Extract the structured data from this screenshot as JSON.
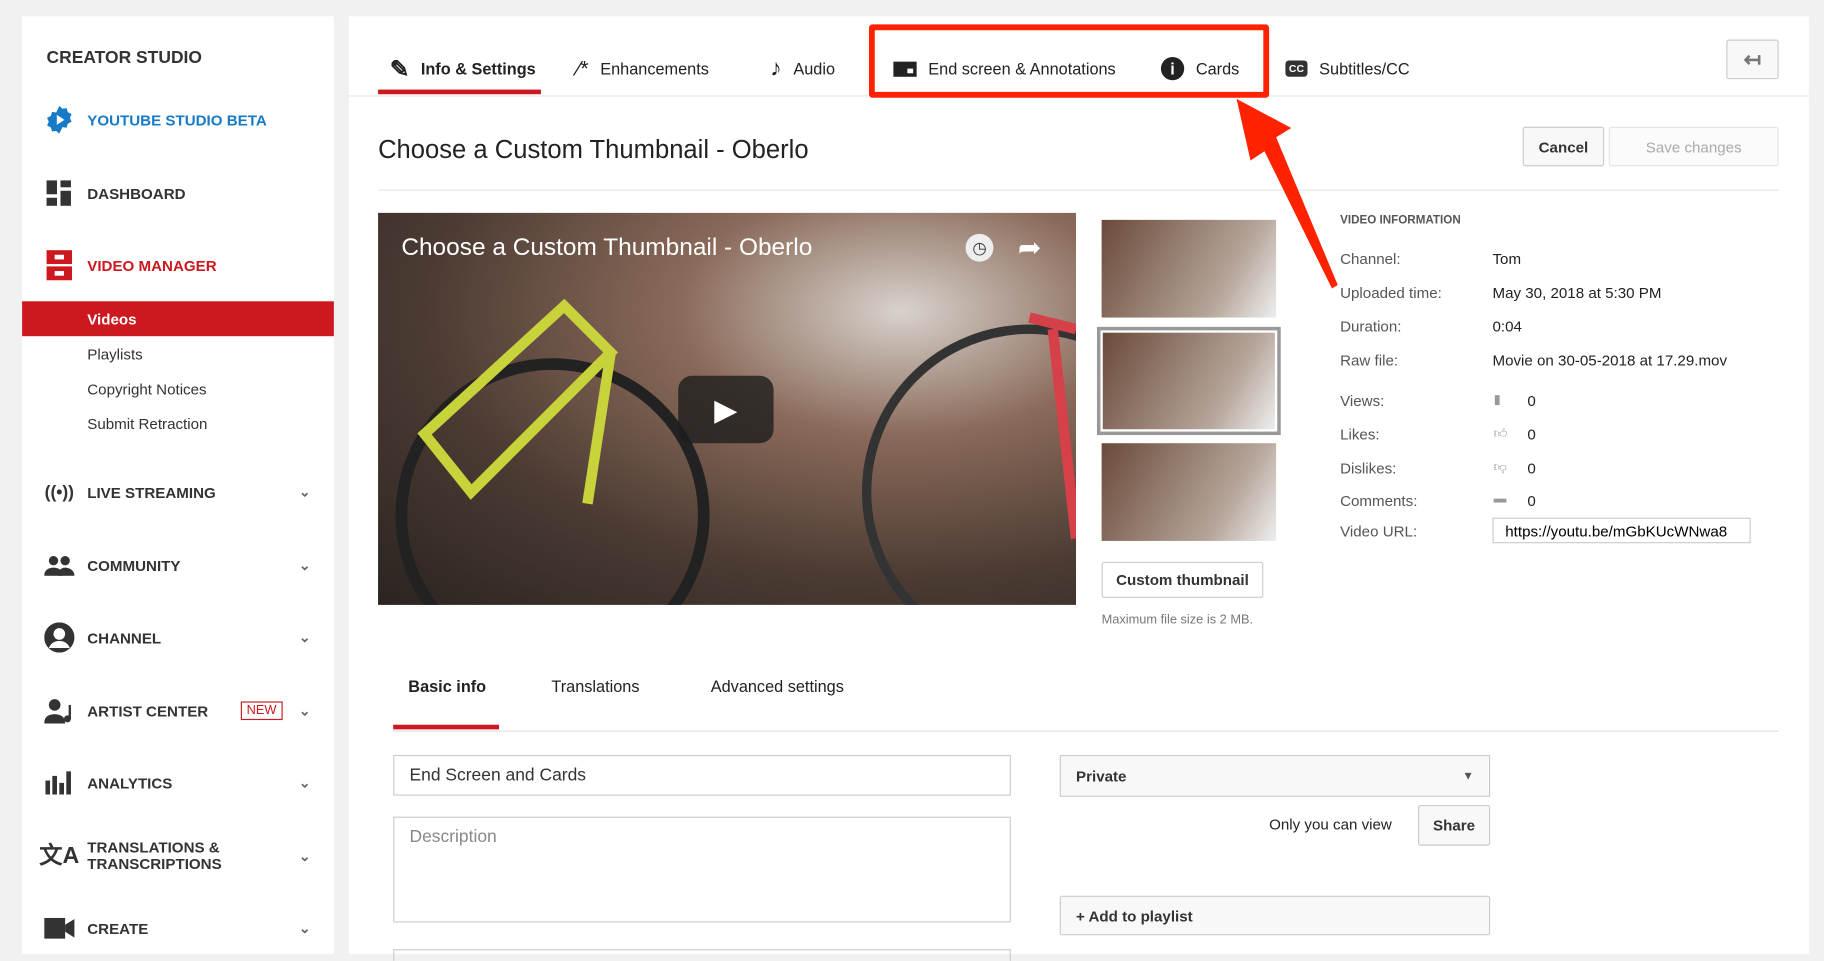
{
  "sidebar": {
    "brand": "CREATOR STUDIO",
    "studio_beta": "YOUTUBE STUDIO BETA",
    "dashboard": "DASHBOARD",
    "video_manager": "VIDEO MANAGER",
    "sub_items": [
      "Videos",
      "Playlists",
      "Copyright Notices",
      "Submit Retraction"
    ],
    "sections": [
      {
        "label": "LIVE STREAMING",
        "icon": "live-icon"
      },
      {
        "label": "COMMUNITY",
        "icon": "community-icon"
      },
      {
        "label": "CHANNEL",
        "icon": "channel-icon"
      },
      {
        "label": "ARTIST CENTER",
        "icon": "artist-icon",
        "badge": "NEW"
      },
      {
        "label": "ANALYTICS",
        "icon": "analytics-icon"
      },
      {
        "label": "TRANSLATIONS & TRANSCRIPTIONS",
        "icon": "translate-icon"
      },
      {
        "label": "CREATE",
        "icon": "camera-icon"
      }
    ]
  },
  "tabs": [
    "Info & Settings",
    "Enhancements",
    "Audio",
    "End screen & Annotations",
    "Cards",
    "Subtitles/CC"
  ],
  "page": {
    "title": "Choose a Custom Thumbnail - Oberlo",
    "cancel": "Cancel",
    "save": "Save changes"
  },
  "video": {
    "title": "Choose a Custom Thumbnail - Oberlo"
  },
  "thumbs": {
    "custom_button": "Custom thumbnail",
    "note": "Maximum file size is 2 MB."
  },
  "info": {
    "heading": "VIDEO INFORMATION",
    "rows": [
      [
        "Channel:",
        "Tom"
      ],
      [
        "Uploaded time:",
        "May 30, 2018 at 5:30 PM"
      ],
      [
        "Duration:",
        "0:04"
      ],
      [
        "Raw file:",
        "Movie on 30-05-2018 at 17.29.mov"
      ]
    ],
    "stats": [
      [
        "Views:",
        "0"
      ],
      [
        "Likes:",
        "0"
      ],
      [
        "Dislikes:",
        "0"
      ],
      [
        "Comments:",
        "0"
      ]
    ],
    "url_label": "Video URL:",
    "url": "https://youtu.be/mGbKUcWNwa8"
  },
  "subtabs": [
    "Basic info",
    "Translations",
    "Advanced settings"
  ],
  "form": {
    "title_value": "End Screen and Cards",
    "description_placeholder": "Description",
    "privacy": "Private",
    "privacy_note": "Only you can view",
    "share": "Share",
    "add_playlist": "+ Add to playlist"
  },
  "colors": {
    "accent": "#cc181e",
    "annotation": "#ff2200",
    "link": "#167ac6"
  }
}
